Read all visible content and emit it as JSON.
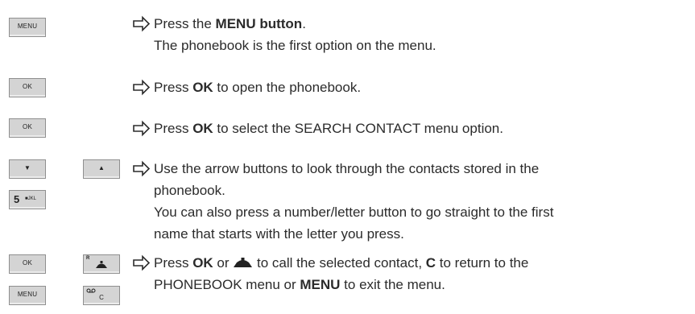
{
  "keys": {
    "menu": "MENU",
    "ok": "OK",
    "five_num": "5",
    "five_letters": "JKL",
    "r_mark": "R",
    "c_letter": "C"
  },
  "steps": [
    {
      "line1": {
        "pre": "Press the ",
        "bold": "MENU button",
        "post": "."
      },
      "line2": "The phonebook is the first option on the menu."
    },
    {
      "pre": "Press ",
      "bold": "OK",
      "post": " to open the phonebook."
    },
    {
      "pre": "Press ",
      "bold": "OK",
      "post": " to select the SEARCH CONTACT menu option."
    },
    {
      "line1": "Use the arrow buttons to look through the contacts stored in the",
      "line2": "phonebook.",
      "line3": "You can also press a number/letter button to go straight to the first",
      "line4": "name that starts with the letter you press."
    },
    {
      "p1": "Press ",
      "b1": "OK",
      "p2": " or ",
      "p3": " to call the selected contact, ",
      "b2": "C",
      "p4": " to return to the",
      "p5": "PHONEBOOK menu or ",
      "b3": "MENU",
      "p6": " to exit the menu."
    }
  ],
  "icons": {
    "step_arrow": "hollow-right-arrow-icon",
    "call": "call-handset-icon",
    "up": "arrow-up-icon",
    "down": "arrow-down-icon",
    "voicemail": "voicemail-icon"
  }
}
